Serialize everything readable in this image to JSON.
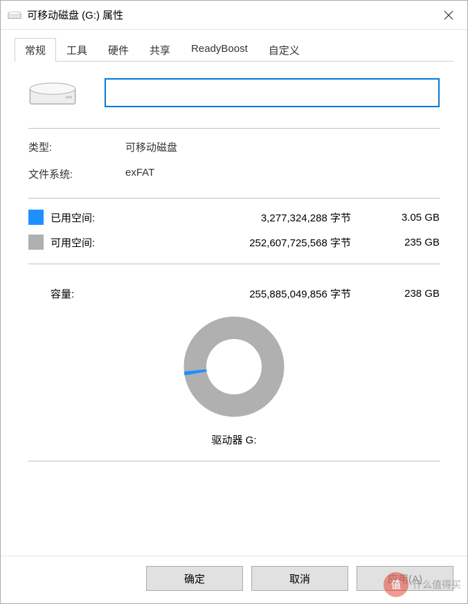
{
  "window": {
    "title": "可移动磁盘 (G:) 属性"
  },
  "tabs": [
    {
      "label": "常规",
      "active": true
    },
    {
      "label": "工具",
      "active": false
    },
    {
      "label": "硬件",
      "active": false
    },
    {
      "label": "共享",
      "active": false
    },
    {
      "label": "ReadyBoost",
      "active": false
    },
    {
      "label": "自定义",
      "active": false
    }
  ],
  "general": {
    "name_value": "",
    "type_label": "类型:",
    "type_value": "可移动磁盘",
    "fs_label": "文件系统:",
    "fs_value": "exFAT",
    "used_label": "已用空间:",
    "used_bytes": "3,277,324,288 字节",
    "used_human": "3.05 GB",
    "used_color": "#1e90ff",
    "free_label": "可用空间:",
    "free_bytes": "252,607,725,568 字节",
    "free_human": "235 GB",
    "free_color": "#b0b0b0",
    "capacity_label": "容量:",
    "capacity_bytes": "255,885,049,856 字节",
    "capacity_human": "238 GB",
    "drive_label": "驱动器 G:"
  },
  "chart_data": {
    "type": "pie",
    "title": "驱动器 G:",
    "series": [
      {
        "name": "已用空间",
        "value": 3277324288,
        "color": "#1e90ff"
      },
      {
        "name": "可用空间",
        "value": 252607725568,
        "color": "#b0b0b0"
      }
    ],
    "total": 255885049856,
    "used_fraction": 0.0128
  },
  "buttons": {
    "ok": "确定",
    "cancel": "取消",
    "apply": "应用(A)"
  },
  "watermark": {
    "badge": "值",
    "text": "什么值得买"
  }
}
